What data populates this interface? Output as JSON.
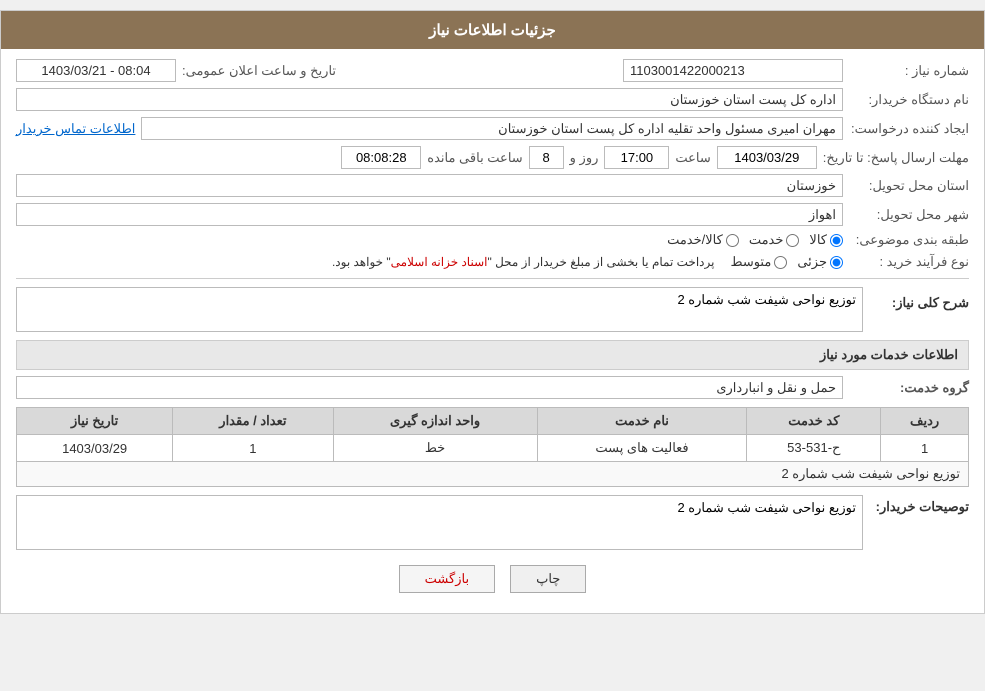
{
  "header": {
    "title": "جزئیات اطلاعات نیاز"
  },
  "fields": {
    "need_number_label": "شماره نیاز :",
    "need_number_value": "1103001422000213",
    "org_label": "نام دستگاه خریدار:",
    "org_value": "اداره کل پست استان خوزستان",
    "creator_label": "ایجاد کننده درخواست:",
    "creator_value": "مهران امیری مسئول واحد تقلیه اداره کل پست استان خوزستان",
    "creator_link": "اطلاعات تماس خریدار",
    "announce_label": "تاریخ و ساعت اعلان عمومی:",
    "announce_value": "1403/03/21 - 08:04",
    "deadline_label": "مهلت ارسال پاسخ: تا تاریخ:",
    "deadline_date": "1403/03/29",
    "deadline_time_label": "ساعت",
    "deadline_time_value": "17:00",
    "deadline_day_label": "روز و",
    "deadline_day_value": "8",
    "deadline_remaining_label": "ساعت باقی مانده",
    "deadline_remaining_value": "08:08:28",
    "province_label": "استان محل تحویل:",
    "province_value": "خوزستان",
    "city_label": "شهر محل تحویل:",
    "city_value": "اهواز",
    "category_label": "طبقه بندی موضوعی:",
    "category_options": [
      "کالا",
      "خدمت",
      "کالا/خدمت"
    ],
    "category_selected": "کالا",
    "process_label": "نوع فرآیند خرید :",
    "process_options": [
      "جزئی",
      "متوسط"
    ],
    "process_selected": "جزئی",
    "process_note": "پرداخت تمام یا بخشی از مبلغ خریدار از محل",
    "process_note_highlight": "اسناد خزانه اسلامی",
    "process_note_end": "خواهد بود.",
    "description_label": "شرح کلی نیاز:",
    "description_value": "توزیع نواحی شیفت شب شماره 2",
    "services_section": "اطلاعات خدمات مورد نیاز",
    "service_group_label": "گروه خدمت:",
    "service_group_value": "حمل و نقل و انبارداری",
    "table": {
      "headers": [
        "ردیف",
        "کد خدمت",
        "نام خدمت",
        "واحد اندازه گیری",
        "تعداد / مقدار",
        "تاریخ نیاز"
      ],
      "rows": [
        {
          "index": "1",
          "code": "ح-531-53",
          "name": "فعالیت های پست",
          "unit": "خط",
          "quantity": "1",
          "date": "1403/03/29"
        }
      ],
      "desc_row": "توزیع نواحی شیفت شب شماره 2"
    },
    "buyer_desc_label": "توصیحات خریدار:",
    "buyer_desc_value": "توزیع نواحی شیفت شب شماره 2"
  },
  "buttons": {
    "print": "چاپ",
    "back": "بازگشت"
  }
}
